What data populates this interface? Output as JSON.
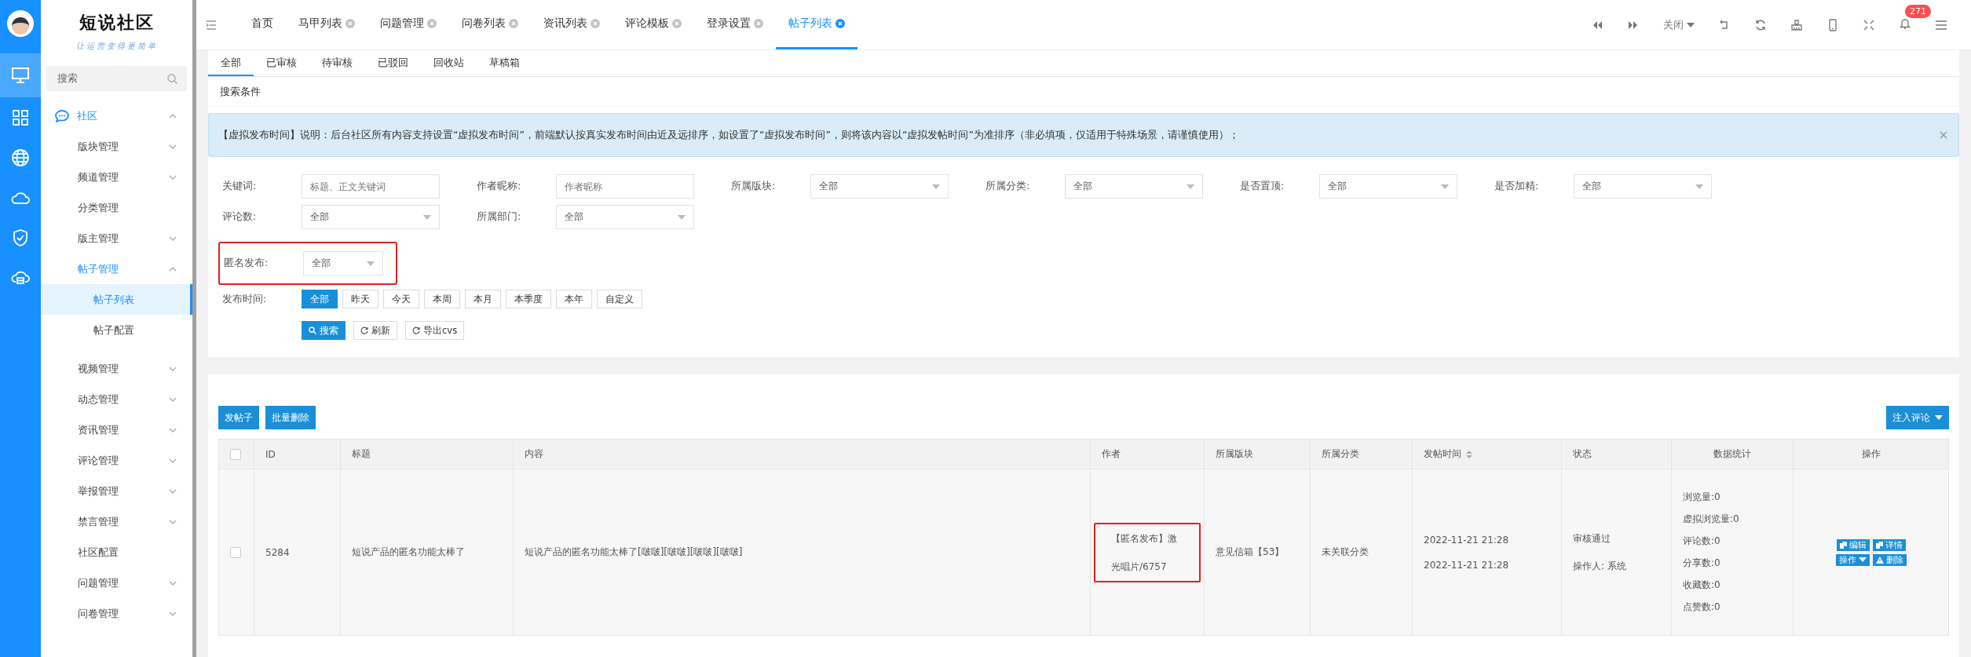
{
  "brand": {
    "title": "短说社区",
    "slogan": "让运营变得更简单"
  },
  "rail": [
    {
      "kind": "monitor",
      "selected": true
    },
    {
      "kind": "grid",
      "selected": false
    },
    {
      "kind": "globe",
      "selected": false
    },
    {
      "kind": "cloud",
      "selected": false
    },
    {
      "kind": "shield",
      "selected": false
    },
    {
      "kind": "cloud-box",
      "selected": false
    }
  ],
  "sidebar": {
    "search_placeholder": "搜索",
    "items": [
      {
        "label": "社区",
        "expandable": true,
        "expanded": true,
        "selected": true,
        "children": [
          {
            "label": "版块管理",
            "expandable": true,
            "expanded": false,
            "selected": false
          },
          {
            "label": "频道管理",
            "expandable": true,
            "expanded": false,
            "selected": false
          },
          {
            "label": "分类管理",
            "expandable": false,
            "expanded": false,
            "selected": false
          },
          {
            "label": "版主管理",
            "expandable": true,
            "expanded": false,
            "selected": false
          },
          {
            "label": "帖子管理",
            "expandable": true,
            "expanded": true,
            "selected": true,
            "children": [
              {
                "label": "帖子列表",
                "expandable": false,
                "expanded": false,
                "selected": true
              },
              {
                "label": "帖子配置",
                "expandable": false,
                "expanded": false,
                "selected": false
              }
            ]
          },
          {
            "label": "视频管理",
            "expandable": true,
            "expanded": false,
            "selected": false
          },
          {
            "label": "动态管理",
            "expandable": true,
            "expanded": false,
            "selected": false
          },
          {
            "label": "资讯管理",
            "expandable": true,
            "expanded": false,
            "selected": false
          },
          {
            "label": "评论管理",
            "expandable": true,
            "expanded": false,
            "selected": false
          },
          {
            "label": "举报管理",
            "expandable": true,
            "expanded": false,
            "selected": false
          },
          {
            "label": "禁言管理",
            "expandable": true,
            "expanded": false,
            "selected": false
          },
          {
            "label": "社区配置",
            "expandable": false,
            "expanded": false,
            "selected": false
          },
          {
            "label": "问题管理",
            "expandable": true,
            "expanded": false,
            "selected": false
          },
          {
            "label": "问卷管理",
            "expandable": true,
            "expanded": false,
            "selected": false
          }
        ]
      }
    ]
  },
  "tabs": [
    {
      "label": "首页",
      "closable": false,
      "selected": false
    },
    {
      "label": "马甲列表",
      "closable": true,
      "selected": false
    },
    {
      "label": "问题管理",
      "closable": true,
      "selected": false
    },
    {
      "label": "问卷列表",
      "closable": true,
      "selected": false
    },
    {
      "label": "资讯列表",
      "closable": true,
      "selected": false
    },
    {
      "label": "评论模板",
      "closable": true,
      "selected": false
    },
    {
      "label": "登录设置",
      "closable": true,
      "selected": false
    },
    {
      "label": "帖子列表",
      "closable": true,
      "selected": true
    }
  ],
  "toolbar": {
    "close_menu": "关闭",
    "notification_count": "271"
  },
  "sub_tabs": [
    {
      "label": "全部",
      "selected": true
    },
    {
      "label": "已审核",
      "selected": false
    },
    {
      "label": "待审核",
      "selected": false
    },
    {
      "label": "已驳回",
      "selected": false
    },
    {
      "label": "回收站",
      "selected": false
    },
    {
      "label": "草稿箱",
      "selected": false
    }
  ],
  "search_panel": {
    "title": "搜索条件",
    "notice": "【虚拟发布时间】说明：后台社区所有内容支持设置“虚拟发布时间”，前端默认按真实发布时间由近及远排序，如设置了“虚拟发布时间”，则将该内容以“虚拟发帖时间”为准排序（非必填项，仅适用于特殊场景，请谨慎使用）；",
    "filters": [
      {
        "label": "关键词:",
        "kind": "text",
        "placeholder": "标题、正文关键词"
      },
      {
        "label": "作者昵称:",
        "kind": "text",
        "placeholder": "作者昵称"
      },
      {
        "label": "所属版块:",
        "kind": "select",
        "value": "全部"
      },
      {
        "label": "所属分类:",
        "kind": "select",
        "value": "全部"
      },
      {
        "label": "是否置顶:",
        "kind": "select",
        "value": "全部"
      },
      {
        "label": "是否加精:",
        "kind": "select",
        "value": "全部"
      },
      {
        "label": "评论数:",
        "kind": "select",
        "value": "全部"
      },
      {
        "label": "所属部门:",
        "kind": "select",
        "value": "全部"
      }
    ],
    "anonymous_filter": {
      "label": "匿名发布:",
      "kind": "select",
      "value": "全部",
      "highlighted": true
    },
    "time_filter": {
      "label": "发布时间:",
      "options": [
        {
          "label": "全部",
          "selected": true
        },
        {
          "label": "昨天",
          "selected": false
        },
        {
          "label": "今天",
          "selected": false
        },
        {
          "label": "本周",
          "selected": false
        },
        {
          "label": "本月",
          "selected": false
        },
        {
          "label": "本季度",
          "selected": false
        },
        {
          "label": "本年",
          "selected": false
        },
        {
          "label": "自定义",
          "selected": false
        }
      ]
    },
    "actions": [
      {
        "label": "搜索",
        "kind": "search"
      },
      {
        "label": "刷新",
        "kind": "refresh"
      },
      {
        "label": "导出cvs",
        "kind": "export"
      }
    ]
  },
  "list": {
    "header_checked": false,
    "buttons": [
      "发帖子",
      "批量删除"
    ],
    "inject_button": "注入评论",
    "columns": [
      "ID",
      "标题",
      "内容",
      "作者",
      "所属版块",
      "所属分类",
      "发帖时间",
      "状态",
      "数据统计",
      "操作"
    ],
    "rows": [
      {
        "checked": false,
        "id": "5284",
        "title": "短说产品的匿名功能太棒了",
        "content": "短说产品的匿名功能太棒了[啵啵][啵啵][啵啵][啵啵]",
        "author": "【匿名发布】激光唱片/6757",
        "author_highlighted": true,
        "board": "意见信箱【53】",
        "category": "未关联分类",
        "times": [
          "2022-11-21 21:28",
          "2022-11-21 21:28"
        ],
        "status": "审核通过",
        "operator": "操作人: 系统",
        "stats": [
          "浏览量:0",
          "虚拟浏览量:0",
          "评论数:0",
          "分享数:0",
          "收藏数:0",
          "点赞数:0"
        ],
        "actions": [
          {
            "label": "编辑",
            "kind": "edit"
          },
          {
            "label": "详情",
            "kind": "detail"
          },
          {
            "label": "操作",
            "kind": "menu"
          },
          {
            "label": "删除",
            "kind": "delete"
          }
        ]
      }
    ]
  }
}
